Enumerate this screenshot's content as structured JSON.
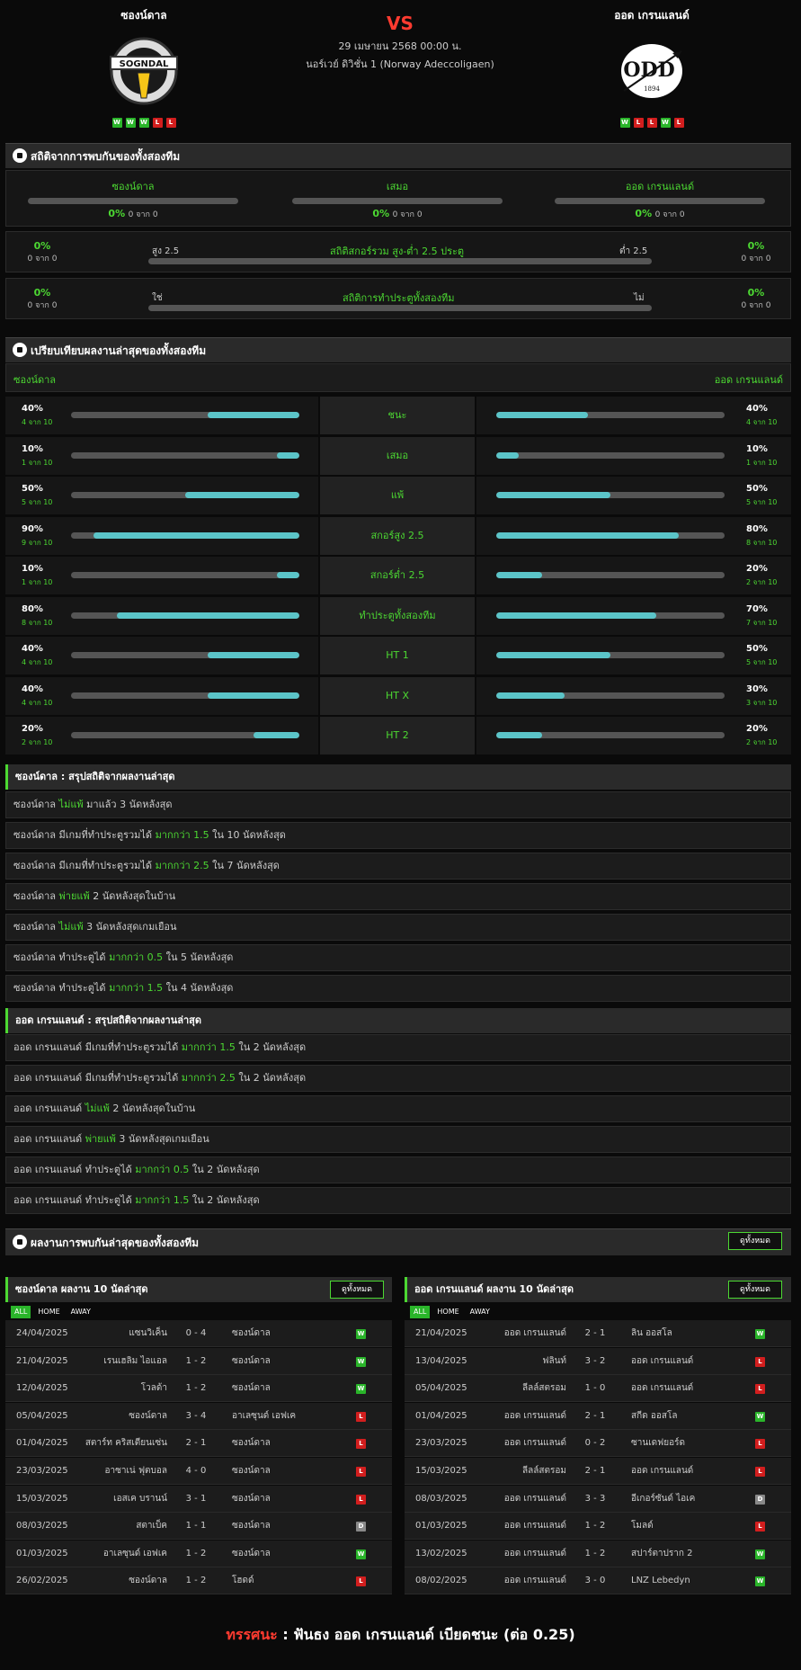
{
  "header": {
    "home_name": "ซองน์ดาล",
    "away_name": "ออด เกรนแลนด์",
    "vs": "VS",
    "date": "29 เมษายน 2568 00:00 น.",
    "league": "นอร์เวย์ ดิวิชั่น 1 (Norway Adeccoligaen)",
    "home_logo_text": "SOGNDAL",
    "away_logo_text": "ODD",
    "away_logo_year": "1894",
    "home_form": [
      "W",
      "W",
      "W",
      "L",
      "L"
    ],
    "away_form": [
      "W",
      "L",
      "L",
      "W",
      "L"
    ]
  },
  "h2h": {
    "title": "สถิติจากการพบกันของทั้งสองทีม",
    "home": "ซองน์ดาล",
    "draw": "เสมอ",
    "away": "ออด เกรนแลนด์",
    "pct": "0%",
    "of": "0 จาก 0"
  },
  "ou": {
    "title": "สถิติสกอร์รวม สูง-ต่ำ 2.5 ประตู",
    "left": "สูง 2.5",
    "right": "ต่ำ 2.5",
    "pct": "0%",
    "of": "0 จาก 0"
  },
  "btts": {
    "title": "สถิติการทำประตูทั้งสองทีม",
    "left": "ใช่",
    "right": "ไม่",
    "pct": "0%",
    "of": "0 จาก 0"
  },
  "compare": {
    "title": "เปรียบเทียบผลงานล่าสุดของทั้งสองทีม",
    "home": "ซองน์ดาล",
    "away": "ออด เกรนแลนด์",
    "rows": [
      {
        "label": "ชนะ",
        "hp": "40%",
        "hs": "4 จาก 10",
        "hv": 0.4,
        "ap": "40%",
        "as": "4 จาก 10",
        "av": 0.4
      },
      {
        "label": "เสมอ",
        "hp": "10%",
        "hs": "1 จาก 10",
        "hv": 0.1,
        "ap": "10%",
        "as": "1 จาก 10",
        "av": 0.1
      },
      {
        "label": "แพ้",
        "hp": "50%",
        "hs": "5 จาก 10",
        "hv": 0.5,
        "ap": "50%",
        "as": "5 จาก 10",
        "av": 0.5
      },
      {
        "label": "สกอร์สูง 2.5",
        "hp": "90%",
        "hs": "9 จาก 10",
        "hv": 0.9,
        "ap": "80%",
        "as": "8 จาก 10",
        "av": 0.8
      },
      {
        "label": "สกอร์ต่ำ 2.5",
        "hp": "10%",
        "hs": "1 จาก 10",
        "hv": 0.1,
        "ap": "20%",
        "as": "2 จาก 10",
        "av": 0.2
      },
      {
        "label": "ทำประตูทั้งสองทีม",
        "hp": "80%",
        "hs": "8 จาก 10",
        "hv": 0.8,
        "ap": "70%",
        "as": "7 จาก 10",
        "av": 0.7
      },
      {
        "label": "HT 1",
        "hp": "40%",
        "hs": "4 จาก 10",
        "hv": 0.4,
        "ap": "50%",
        "as": "5 จาก 10",
        "av": 0.5
      },
      {
        "label": "HT X",
        "hp": "40%",
        "hs": "4 จาก 10",
        "hv": 0.4,
        "ap": "30%",
        "as": "3 จาก 10",
        "av": 0.3
      },
      {
        "label": "HT 2",
        "hp": "20%",
        "hs": "2 จาก 10",
        "hv": 0.2,
        "ap": "20%",
        "as": "2 จาก 10",
        "av": 0.2
      }
    ]
  },
  "home_summary": {
    "team": "ซองน์ดาล",
    "title": " : สรุปสถิติจากผลงานล่าสุด",
    "rows": [
      [
        "ซองน์ดาล ",
        "ไม่แพ้",
        " มาแล้ว 3 นัดหลังสุด"
      ],
      [
        "ซองน์ดาล มีเกมที่ทำประตูรวมได้ ",
        "มากกว่า 1.5",
        " ใน 10 นัดหลังสุด"
      ],
      [
        "ซองน์ดาล มีเกมที่ทำประตูรวมได้ ",
        "มากกว่า 2.5",
        " ใน 7 นัดหลังสุด"
      ],
      [
        "ซองน์ดาล ",
        "พ่ายแพ้",
        " 2 นัดหลังสุดในบ้าน"
      ],
      [
        "ซองน์ดาล ",
        "ไม่แพ้",
        " 3 นัดหลังสุดเกมเยือน"
      ],
      [
        "ซองน์ดาล ทำประตูได้ ",
        "มากกว่า 0.5",
        " ใน 5 นัดหลังสุด"
      ],
      [
        "ซองน์ดาล ทำประตูได้ ",
        "มากกว่า 1.5",
        " ใน 4 นัดหลังสุด"
      ]
    ]
  },
  "away_summary": {
    "team": "ออด เกรนแลนด์",
    "title": " : สรุปสถิติจากผลงานล่าสุด",
    "rows": [
      [
        "ออด เกรนแลนด์ มีเกมที่ทำประตูรวมได้ ",
        "มากกว่า 1.5",
        " ใน 2 นัดหลังสุด"
      ],
      [
        "ออด เกรนแลนด์ มีเกมที่ทำประตูรวมได้ ",
        "มากกว่า 2.5",
        " ใน 2 นัดหลังสุด"
      ],
      [
        "ออด เกรนแลนด์ ",
        "ไม่แพ้",
        " 2 นัดหลังสุดในบ้าน"
      ],
      [
        "ออด เกรนแลนด์ ",
        "พ่ายแพ้",
        " 3 นัดหลังสุดเกมเยือน"
      ],
      [
        "ออด เกรนแลนด์ ทำประตูได้ ",
        "มากกว่า 0.5",
        " ใน 2 นัดหลังสุด"
      ],
      [
        "ออด เกรนแลนด์ ทำประตูได้ ",
        "มากกว่า 1.5",
        " ใน 2 นัดหลังสุด"
      ]
    ]
  },
  "recent": {
    "title": "ผลงานการพบกันล่าสุดของทั้งสองทีม",
    "view_all": "ดูทั้งหมด",
    "tab_all": "ALL",
    "tab_home": "HOME",
    "tab_away": "AWAY",
    "home_title": "ซองน์ดาล ผลงาน 10 นัดล่าสุด",
    "away_title": "ออด เกรนแลนด์ ผลงาน 10 นัดล่าสุด",
    "home_matches": [
      [
        "24/04/2025",
        "แซนวิเค็น",
        "0 - 4",
        "ซองน์ดาล",
        "W"
      ],
      [
        "21/04/2025",
        "เรนเฮลิม ไอแอล",
        "1 - 2",
        "ซองน์ดาล",
        "W"
      ],
      [
        "12/04/2025",
        "โวลด้า",
        "1 - 2",
        "ซองน์ดาล",
        "W"
      ],
      [
        "05/04/2025",
        "ซองน์ดาล",
        "3 - 4",
        "อาเลซุนด์ เอฟเค",
        "L"
      ],
      [
        "01/04/2025",
        "สตาร์ท คริสเตียนเซ่น",
        "2 - 1",
        "ซองน์ดาล",
        "L"
      ],
      [
        "23/03/2025",
        "อาซาเน่ ฟุตบอล",
        "4 - 0",
        "ซองน์ดาล",
        "L"
      ],
      [
        "15/03/2025",
        "เอสเค บรานน์",
        "3 - 1",
        "ซองน์ดาล",
        "L"
      ],
      [
        "08/03/2025",
        "สตาเบ็ค",
        "1 - 1",
        "ซองน์ดาล",
        "D"
      ],
      [
        "01/03/2025",
        "อาเลซุนด์ เอฟเค",
        "1 - 2",
        "ซองน์ดาล",
        "W"
      ],
      [
        "26/02/2025",
        "ซองน์ดาล",
        "1 - 2",
        "โฮดด์",
        "L"
      ]
    ],
    "away_matches": [
      [
        "21/04/2025",
        "ออด เกรนแลนด์",
        "2 - 1",
        "ลิน ออสโล",
        "W"
      ],
      [
        "13/04/2025",
        "ฟลินท์",
        "3 - 2",
        "ออด เกรนแลนด์",
        "L"
      ],
      [
        "05/04/2025",
        "ลีลล์สตรอม",
        "1 - 0",
        "ออด เกรนแลนด์",
        "L"
      ],
      [
        "01/04/2025",
        "ออด เกรนแลนด์",
        "2 - 1",
        "สกีด ออสโล",
        "W"
      ],
      [
        "23/03/2025",
        "ออด เกรนแลนด์",
        "0 - 2",
        "ซานเดฟยอร์ด",
        "L"
      ],
      [
        "15/03/2025",
        "ลีลล์สตรอม",
        "2 - 1",
        "ออด เกรนแลนด์",
        "L"
      ],
      [
        "08/03/2025",
        "ออด เกรนแลนด์",
        "3 - 3",
        "อีเกอร์ซันด์ ไอเค",
        "D"
      ],
      [
        "01/03/2025",
        "ออด เกรนแลนด์",
        "1 - 2",
        "โมลด์",
        "L"
      ],
      [
        "13/02/2025",
        "ออด เกรนแลนด์",
        "1 - 2",
        "สปาร์ตาปราก 2",
        "W"
      ],
      [
        "08/02/2025",
        "ออด เกรนแลนด์",
        "3 - 0",
        "LNZ Lebedyn",
        "W"
      ]
    ]
  },
  "verdict": {
    "label": "ทรรศนะ",
    "sep": " : ",
    "text": "ฟันธง ออด เกรนแลนด์ เบียดชนะ (ต่อ 0.25)"
  },
  "colors": {
    "accent": "#4cd832",
    "bar_fill": "#5bc4c8",
    "win": "#2ab52a",
    "loss": "#d21e1e",
    "draw": "#888888",
    "vs": "#ff3b30"
  }
}
